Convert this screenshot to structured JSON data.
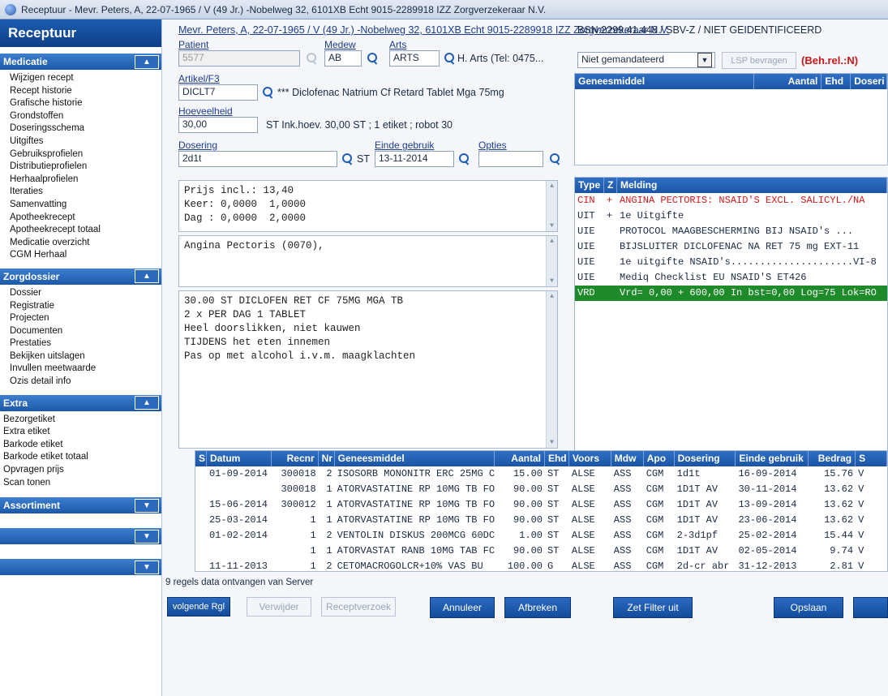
{
  "window": {
    "title": "Receptuur - Mevr. Peters, A, 22-07-1965 / V (49 Jr.) -Nobelweg 32, 6101XB Echt 9015-2289918 IZZ Zorgverzekeraar N.V."
  },
  "sidebar": {
    "title": "Receptuur",
    "sections": [
      {
        "title": "Medicatie",
        "items": [
          "Wijzigen recept",
          "Recept historie",
          "Grafische historie",
          "Grondstoffen",
          "Doseringsschema",
          "Uitgiftes",
          "Gebruiksprofielen",
          "Distributieprofielen",
          "Herhaalprofielen",
          "Iteraties",
          "Samenvatting",
          "Apotheekrecept",
          "Apotheekrecept totaal",
          "Medicatie overzicht",
          "CGM Herhaal"
        ]
      },
      {
        "title": "Zorgdossier",
        "items": [
          "Dossier",
          "Registratie",
          "Projecten",
          "Documenten",
          "Prestaties",
          "Bekijken uitslagen",
          "Invullen meetwaarde",
          "Ozis detail info"
        ]
      },
      {
        "title": "Extra",
        "items": [
          "Bezorgetiket",
          "Extra etiket",
          "Barkode etiket",
          "Barkode etiket totaal",
          "Opvragen prijs",
          "Scan tonen"
        ]
      },
      {
        "title": "Assortiment"
      }
    ]
  },
  "patient": {
    "header": "Mevr. Peters, A, 22-07-1965 / V (49 Jr.) -Nobelweg 32, 6101XB Echt 9015-2289918 IZZ Zorgverzekeraar N.V."
  },
  "labels": {
    "patient": "Patient",
    "medew": "Medew",
    "arts": "Arts",
    "artikel": "Artikel/F3",
    "hoeveelheid": "Hoeveelheid",
    "dosering": "Dosering",
    "einde_gebruik": "Einde gebruik",
    "opties": "Opties"
  },
  "form": {
    "patient_value": "5577",
    "medew_value": "AB",
    "arts_value": "ARTS",
    "arts_description": "H. Arts (Tel: 0475...",
    "artikel_value": "DICLT7",
    "artikel_description": "*** Diclofenac Natrium Cf Retard Tablet Mga 75mg",
    "hoeveelheid_value": "30,00",
    "hoeveelheid_description": "ST  Ink.hoev. 30,00 ST ; 1 etiket ; robot 30",
    "dosering_value": "2d1t",
    "dosering_unit": "ST",
    "einde_gebruik_value": "13-11-2014"
  },
  "panels": {
    "price": "Prijs incl.: 13,40\nKeer: 0,0000  1,0000\nDag : 0,0000  2,0000",
    "indication": "Angina Pectoris (0070),",
    "label_text": "30.00 ST DICLOFEN RET CF 75MG MGA TB\n2 x PER DAG 1 TABLET\nHeel doorslikken, niet kauwen\nTIJDENS het eten innemen\nPas op met alcohol i.v.m. maagklachten"
  },
  "right": {
    "bsn": "BSN:2299.41.448 / SBV-Z / NIET GEIDENTIFICEERD",
    "mandate_select": "Niet gemandateerd",
    "lsp_button": "LSP bevragen",
    "beh_rel": "(Beh.rel.:N)",
    "geneesmiddel_columns": [
      "Geneesmiddel",
      "Aantal",
      "Ehd",
      "Doseri"
    ]
  },
  "meldingen": {
    "columns": [
      "Type",
      "Z",
      "Melding"
    ],
    "rows": [
      {
        "type": "CIN",
        "z": "+",
        "text": "ANGINA PECTORIS: NSAID'S EXCL. SALICYL./NA"
      },
      {
        "type": "UIT",
        "z": "+",
        "text": "1e Uitgifte"
      },
      {
        "type": "UIE",
        "z": "",
        "text": "PROTOCOL MAAGBESCHERMING BIJ NSAID's ..."
      },
      {
        "type": "UIE",
        "z": "",
        "text": "BIJSLUITER DICLOFENAC NA RET 75 mg EXT-11"
      },
      {
        "type": "UIE",
        "z": "",
        "text": "1e uitgifte NSAID's.....................VI-8"
      },
      {
        "type": "UIE",
        "z": "",
        "text": "Mediq Checklist EU NSAID'S ET426"
      },
      {
        "type": "VRD",
        "z": "",
        "text": "Vrd= 0,00 + 600,00 In bst=0,00 Log=75 Lok=RO"
      }
    ]
  },
  "history": {
    "columns": [
      "S",
      "Datum",
      "Recnr",
      "Nr",
      "Geneesmiddel",
      "Aantal",
      "Ehd",
      "Voors",
      "Mdw",
      "Apo",
      "Dosering",
      "Einde gebruik",
      "Bedrag",
      "S"
    ],
    "rows": [
      {
        "datum": "01-09-2014",
        "recnr": "300018",
        "nr": "2",
        "geneesmiddel": "ISOSORB MONONITR ERC 25MG C",
        "aantal": "15.00",
        "ehd": "ST",
        "voors": "ALSE",
        "mdw": "ASS",
        "apo": "CGM",
        "dosering": "1d1t",
        "einde": "16-09-2014",
        "bedrag": "15.76",
        "s": "V"
      },
      {
        "datum": "",
        "recnr": "300018",
        "nr": "1",
        "geneesmiddel": "ATORVASTATINE RP 10MG TB FO",
        "aantal": "90.00",
        "ehd": "ST",
        "voors": "ALSE",
        "mdw": "ASS",
        "apo": "CGM",
        "dosering": "1D1T AV",
        "einde": "30-11-2014",
        "bedrag": "13.62",
        "s": "V"
      },
      {
        "datum": "15-06-2014",
        "recnr": "300012",
        "nr": "1",
        "geneesmiddel": "ATORVASTATINE RP 10MG TB FO",
        "aantal": "90.00",
        "ehd": "ST",
        "voors": "ALSE",
        "mdw": "ASS",
        "apo": "CGM",
        "dosering": "1D1T AV",
        "einde": "13-09-2014",
        "bedrag": "13.62",
        "s": "V"
      },
      {
        "datum": "25-03-2014",
        "recnr": "1",
        "nr": "1",
        "geneesmiddel": "ATORVASTATINE RP 10MG TB FO",
        "aantal": "90.00",
        "ehd": "ST",
        "voors": "ALSE",
        "mdw": "ASS",
        "apo": "CGM",
        "dosering": "1D1T AV",
        "einde": "23-06-2014",
        "bedrag": "13.62",
        "s": "V"
      },
      {
        "datum": "01-02-2014",
        "recnr": "1",
        "nr": "2",
        "geneesmiddel": "VENTOLIN DISKUS 200MCG 60DC",
        "aantal": "1.00",
        "ehd": "ST",
        "voors": "ALSE",
        "mdw": "ASS",
        "apo": "CGM",
        "dosering": "2-3d1pf",
        "einde": "25-02-2014",
        "bedrag": "15.44",
        "s": "V"
      },
      {
        "datum": "",
        "recnr": "1",
        "nr": "1",
        "geneesmiddel": "ATORVASTAT RANB 10MG TAB FC",
        "aantal": "90.00",
        "ehd": "ST",
        "voors": "ALSE",
        "mdw": "ASS",
        "apo": "CGM",
        "dosering": "1D1T AV",
        "einde": "02-05-2014",
        "bedrag": "9.74",
        "s": "V"
      },
      {
        "datum": "11-11-2013",
        "recnr": "1",
        "nr": "2",
        "geneesmiddel": "CETOMACROGOLCR+10% VAS BU",
        "aantal": "100.00",
        "ehd": "G",
        "voors": "ALSE",
        "mdw": "ASS",
        "apo": "CGM",
        "dosering": "2d-cr abr",
        "einde": "31-12-2013",
        "bedrag": "2.81",
        "s": "V"
      }
    ]
  },
  "status": {
    "message": "9 regels data ontvangen van Server"
  },
  "buttons": {
    "volgende": "volgende Rgl",
    "verwijder": "Verwijder",
    "receptverzoek": "Receptverzoek",
    "annuleer": "Annuleer",
    "afbreken": "Afbreken",
    "zet_filter_uit": "Zet Filter uit",
    "opslaan": "Opslaan"
  },
  "colors": {
    "header_blue": "#1c54a4",
    "warning_red": "#d01a1a",
    "highlight_green": "#1e8a2a"
  }
}
